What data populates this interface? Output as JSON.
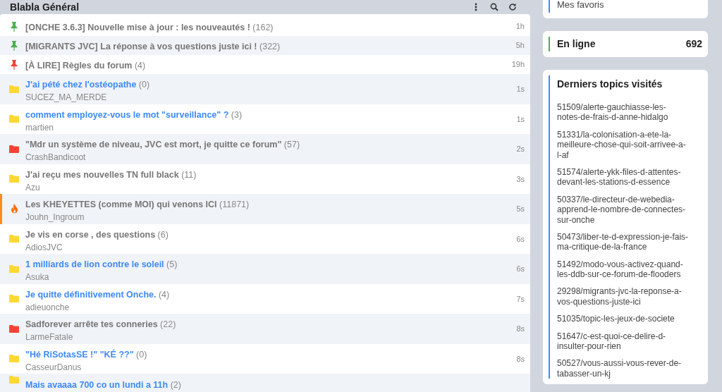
{
  "forum": {
    "title": "Blabla Général"
  },
  "topics": [
    {
      "kind": "pinned",
      "color": "#4caf50",
      "title": "[ONCHE 3.6.3] Nouvelle mise à jour : les nouveautés !",
      "count": "(162)",
      "time": "1h",
      "unread": false
    },
    {
      "kind": "pinned",
      "color": "#4caf50",
      "title": "[MIGRANTS JVC] La réponse à vos questions juste ici !",
      "count": "(322)",
      "time": "5h",
      "unread": false
    },
    {
      "kind": "pinned",
      "color": "#f44336",
      "title": "[À LIRE] Règles du forum",
      "count": "(4)",
      "time": "19h",
      "unread": false
    },
    {
      "kind": "folder",
      "color": "#fdd835",
      "title": "J'ai pété chez l'ostéopathe",
      "count": "(0)",
      "author": "SUCEZ_MA_MERDE",
      "time": "1s",
      "unread": true
    },
    {
      "kind": "folder",
      "color": "#fdd835",
      "title": "comment employez-vous le mot \"surveillance\" ?",
      "count": "(3)",
      "author": "martien",
      "time": "1s",
      "unread": true
    },
    {
      "kind": "folder",
      "color": "#f44336",
      "title": "\"Mdr un système de niveau, JVC est mort, je quitte ce forum\"",
      "count": "(57)",
      "author": "CrashBandicoot",
      "time": "2s",
      "unread": false
    },
    {
      "kind": "folder",
      "color": "#fdd835",
      "title": "J'ai reçu mes nouvelles TN full black",
      "count": "(11)",
      "author": "Azu",
      "time": "3s",
      "unread": false
    },
    {
      "kind": "hot",
      "color": "#ff6d00",
      "title": "Les KHEYETTES (comme MOI) qui venons ICI",
      "count": "(11871)",
      "author": "Jouhn_Ingroum",
      "time": "5s",
      "unread": false
    },
    {
      "kind": "folder",
      "color": "#fdd835",
      "title": "Je vis en corse , des questions",
      "count": "(6)",
      "author": "AdiosJVC",
      "time": "6s",
      "unread": false
    },
    {
      "kind": "folder",
      "color": "#fdd835",
      "title": "1 milliards de lion contre le soleil",
      "count": "(5)",
      "author": "Asuka",
      "time": "6s",
      "unread": true
    },
    {
      "kind": "folder",
      "color": "#fdd835",
      "title": "Je quitte définitivement Onche.",
      "count": "(4)",
      "author": "adieuonche",
      "time": "7s",
      "unread": true
    },
    {
      "kind": "folder",
      "color": "#f44336",
      "title": "Sadforever arrête tes conneries",
      "count": "(22)",
      "author": "LarmeFatale",
      "time": "8s",
      "unread": false
    },
    {
      "kind": "folder",
      "color": "#fdd835",
      "title": "\"Hé RiSotasSE !\" \"KÉ ??\"",
      "count": "(0)",
      "author": "CasseurDanus",
      "time": "8s",
      "unread": true
    },
    {
      "kind": "folder",
      "color": "#fdd835",
      "title": "Mais avaaaa 700 co un lundi a 11h",
      "count": "(2)",
      "unread": true
    }
  ],
  "sidebar": {
    "favorites_title": "Mes favoris",
    "online": {
      "label": "En ligne",
      "value": "692"
    },
    "recent": {
      "title": "Derniers topics visités",
      "links": [
        "51509/alerte-gauchiasse-les-notes-de-frais-d-anne-hidalgo",
        "51331/la-colonisation-a-ete-la-meilleure-chose-qui-soit-arrivee-a-l-af",
        "51574/alerte-ykk-files-d-attentes-devant-les-stations-d-essence",
        "50337/le-directeur-de-webedia-apprend-le-nombre-de-connectes-sur-onche",
        "50473/liber-te-d-expression-je-fais-ma-critique-de-la-france",
        "51492/modo-vous-activez-quand-les-ddb-sur-ce-forum-de-flooders",
        "29298/migrants-jvc-la-reponse-a-vos-questions-juste-ici",
        "51035/topic-les-jeux-de-societe",
        "51647/c-est-quoi-ce-delire-d-insulter-pour-rien",
        "50527/vous-aussi-vous-rever-de-tabasser-un-kj"
      ]
    }
  }
}
